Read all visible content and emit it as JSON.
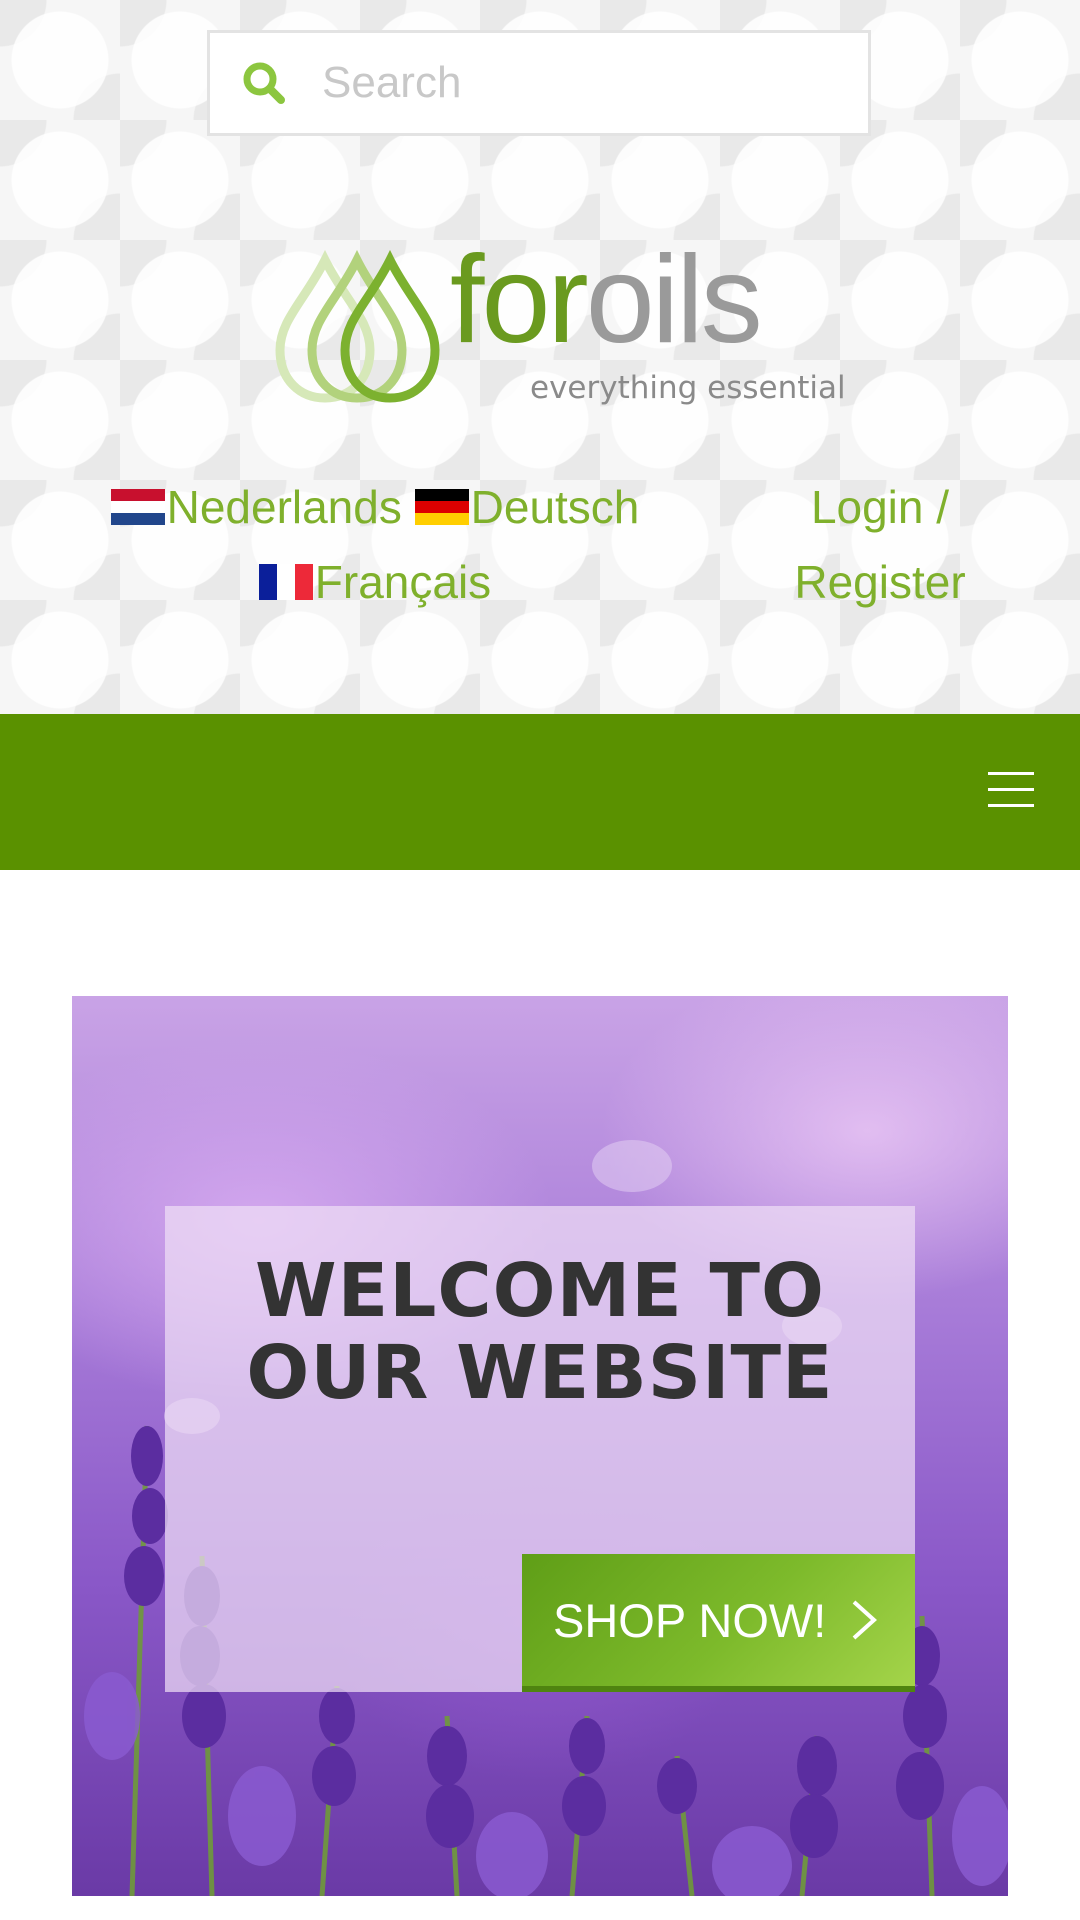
{
  "search": {
    "placeholder": "Search"
  },
  "logo": {
    "word_for": "for",
    "word_oils": "oils",
    "tagline": "everything essential"
  },
  "languages": [
    {
      "label": "Nederlands",
      "flag": "flag-netherlands-icon"
    },
    {
      "label": "Deutsch",
      "flag": "flag-germany-icon"
    },
    {
      "label": "Français",
      "flag": "flag-france-icon"
    }
  ],
  "account": {
    "login_label": "Login /",
    "register_label": "Register"
  },
  "nav": {
    "menu_icon": "hamburger-menu-icon"
  },
  "hero": {
    "title_line1": "WELCOME TO",
    "title_line2": "OUR WEBSITE",
    "cta_label": "SHOP NOW!",
    "cta_icon": "chevron-right-icon"
  },
  "colors": {
    "brand_green": "#5a9100",
    "link_green": "#7fb02c",
    "logo_grey": "#9a9a9a",
    "title_text": "#333333",
    "hero_purple": "#8a58c8"
  }
}
